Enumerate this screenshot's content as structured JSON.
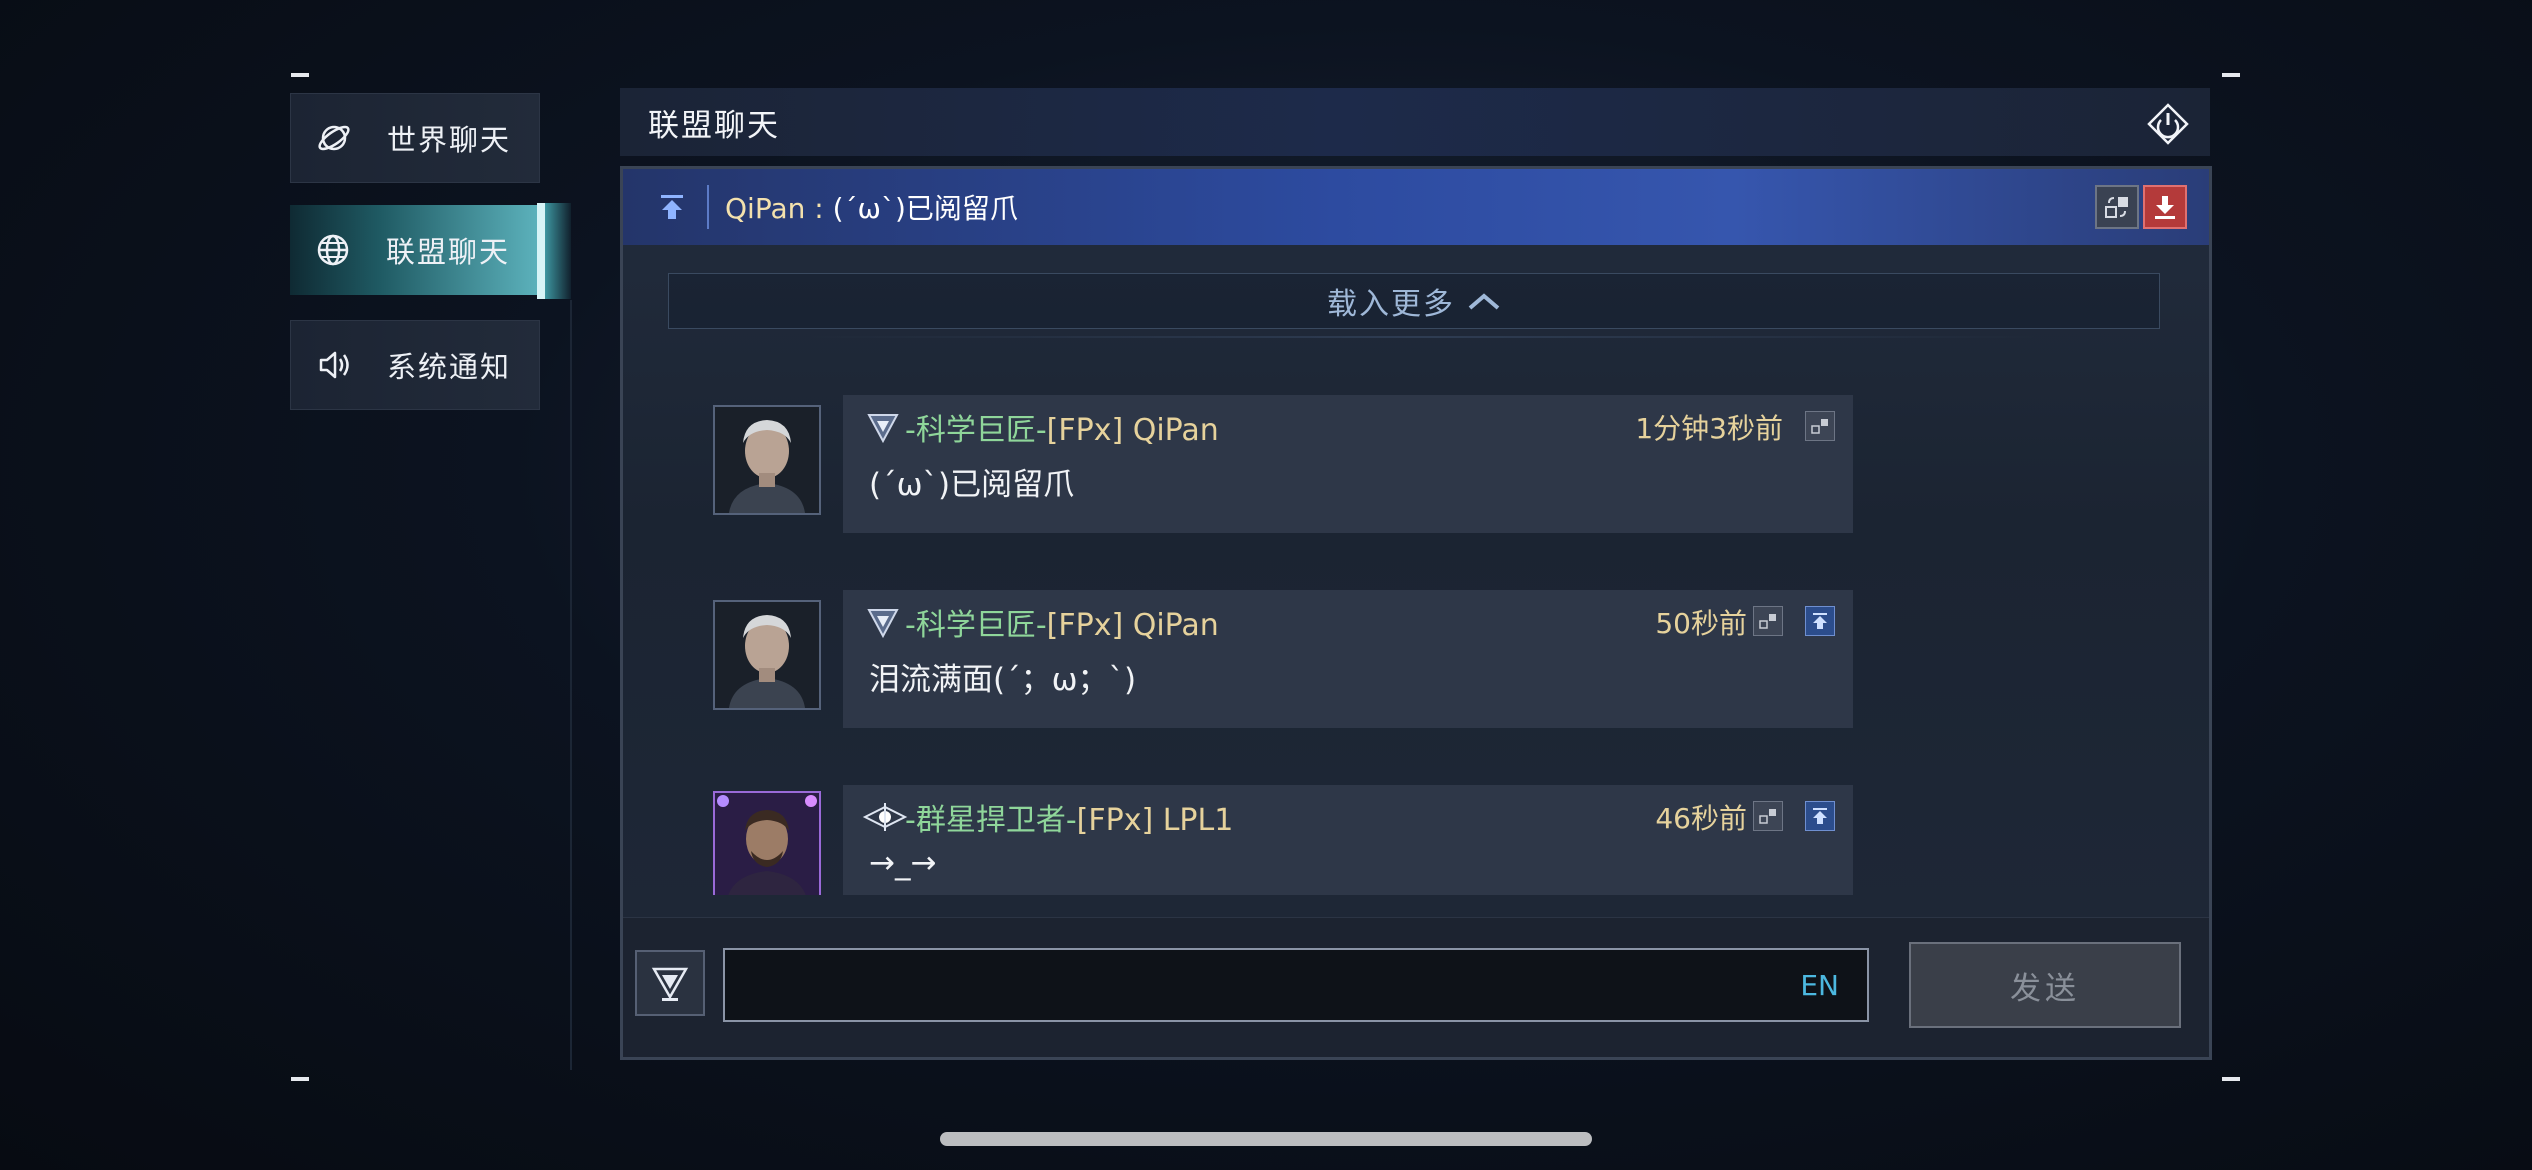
{
  "sidebar": {
    "items": [
      {
        "label": "世界聊天",
        "icon": "planet-icon",
        "active": false
      },
      {
        "label": "联盟聊天",
        "icon": "globe-icon",
        "active": true
      },
      {
        "label": "系统通知",
        "icon": "speaker-icon",
        "active": false
      }
    ]
  },
  "header": {
    "title": "联盟聊天",
    "exit_icon": "exit-icon"
  },
  "pinned": {
    "sender": "QiPan",
    "separator": " : ",
    "message": "(´ω`)已阅留爪"
  },
  "load_more": {
    "label": "载入更多"
  },
  "messages": [
    {
      "alliance": "-科学巨匠-",
      "tag": "[FPx] QiPan",
      "text": "(´ω`)已阅留爪",
      "time": "1分钟3秒前"
    },
    {
      "alliance": "-科学巨匠-",
      "tag": "[FPx] QiPan",
      "text": "泪流满面(´；ω；`)",
      "time": "50秒前"
    },
    {
      "alliance": "-群星捍卫者-",
      "tag": "[FPx] LPL1",
      "text": "→_→",
      "time": "46秒前"
    }
  ],
  "input": {
    "placeholder": "",
    "lang": "EN"
  },
  "send": {
    "label": "发送"
  },
  "colors": {
    "accent": "#5fb6c0",
    "alliance_name": "#8fd69a",
    "gold": "#e6d29c",
    "pinned_bg": "#2d4ba0"
  }
}
